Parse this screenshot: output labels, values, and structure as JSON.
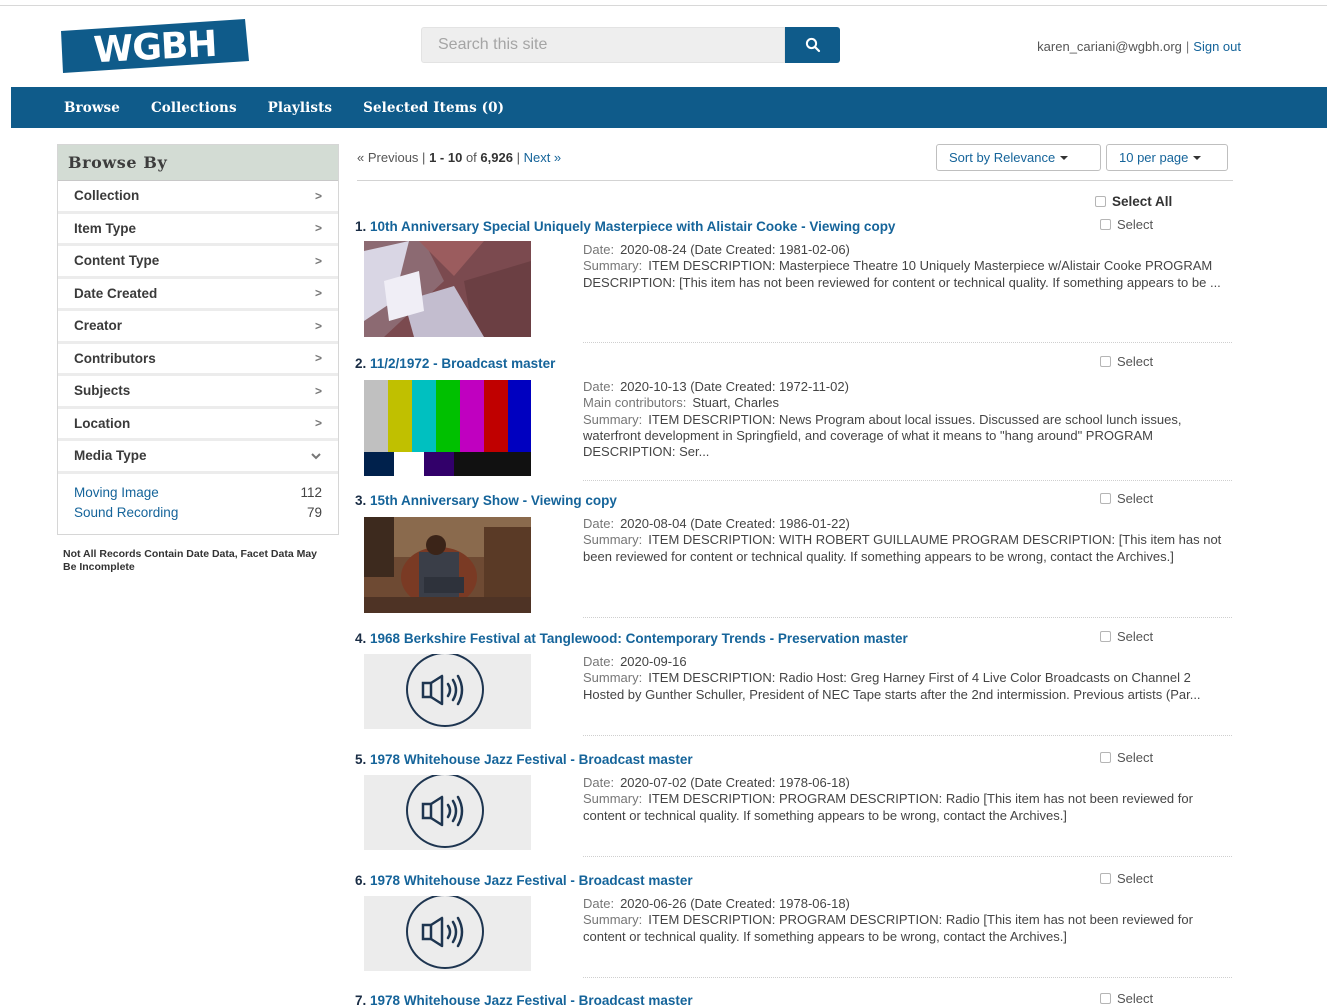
{
  "header": {
    "logo_text": "WGBH",
    "search_placeholder": "Search this site",
    "user_email": "karen_cariani@wgbh.org",
    "user_separator": "|",
    "sign_out_label": "Sign out"
  },
  "nav": {
    "items": [
      "Browse",
      "Collections",
      "Playlists",
      "Selected Items (0)"
    ]
  },
  "sidebar": {
    "title": "Browse By",
    "facets": [
      "Collection",
      "Item Type",
      "Content Type",
      "Date Created",
      "Creator",
      "Contributors",
      "Subjects",
      "Location",
      "Media Type"
    ],
    "media_type_options": [
      {
        "label": "Moving Image",
        "count": "112"
      },
      {
        "label": "Sound Recording",
        "count": "79"
      }
    ],
    "note": "Not All Records Contain Date Data, Facet Data May Be Incomplete"
  },
  "results_header": {
    "previous_label": "« Previous",
    "sep1": "|",
    "range": "1 - 10",
    "of_label": "of",
    "total": "6,926",
    "sep2": "|",
    "next_label": "Next »",
    "sort_label": "Sort by Relevance",
    "per_page_label": "10 per page",
    "select_all_label": "Select All"
  },
  "results": [
    {
      "num": "1.",
      "title": "10th Anniversary Special Uniquely Masterpiece with Alistair Cooke - Viewing copy",
      "select_label": "Select",
      "thumb": "video-still",
      "date_key": "Date:",
      "date": "2020-08-24 (Date Created: 1981-02-06)",
      "contributors_key": "",
      "contributors": "",
      "summary_key": "Summary:",
      "summary": "ITEM DESCRIPTION: Masterpiece Theatre 10 Uniquely Masterpiece w/Alistair Cooke PROGRAM DESCRIPTION: [This item has not been reviewed for content or technical quality. If something appears to be ..."
    },
    {
      "num": "2.",
      "title": "11/2/1972 - Broadcast master",
      "select_label": "Select",
      "thumb": "color-bars",
      "date_key": "Date:",
      "date": "2020-10-13 (Date Created: 1972-11-02)",
      "contributors_key": "Main contributors:",
      "contributors": "Stuart, Charles",
      "summary_key": "Summary:",
      "summary": "ITEM DESCRIPTION: News Program about local issues. Discussed are school lunch issues, waterfront development in Springfield, and coverage of what it means to \"hang around\" PROGRAM DESCRIPTION: Ser..."
    },
    {
      "num": "3.",
      "title": "15th Anniversary Show - Viewing copy",
      "select_label": "Select",
      "thumb": "video-still",
      "date_key": "Date:",
      "date": "2020-08-04 (Date Created: 1986-01-22)",
      "contributors_key": "",
      "contributors": "",
      "summary_key": "Summary:",
      "summary": "ITEM DESCRIPTION: WITH ROBERT GUILLAUME PROGRAM DESCRIPTION: [This item has not been reviewed for content or technical quality. If something appears to be wrong, contact the Archives.]"
    },
    {
      "num": "4.",
      "title": "1968 Berkshire Festival at Tanglewood: Contemporary Trends - Preservation master",
      "select_label": "Select",
      "thumb": "audio",
      "date_key": "Date:",
      "date": "2020-09-16",
      "contributors_key": "",
      "contributors": "",
      "summary_key": "Summary:",
      "summary": "ITEM DESCRIPTION: Radio Host: Greg Harney First of 4 Live Color Broadcasts on Channel 2 Hosted by Gunther Schuller, President of NEC Tape starts after the 2nd intermission. Previous artists (Par..."
    },
    {
      "num": "5.",
      "title": "1978 Whitehouse Jazz Festival - Broadcast master",
      "select_label": "Select",
      "thumb": "audio",
      "date_key": "Date:",
      "date": "2020-07-02 (Date Created: 1978-06-18)",
      "contributors_key": "",
      "contributors": "",
      "summary_key": "Summary:",
      "summary": "ITEM DESCRIPTION: PROGRAM DESCRIPTION: Radio [This item has not been reviewed for content or technical quality. If something appears to be wrong, contact the Archives.]"
    },
    {
      "num": "6.",
      "title": "1978 Whitehouse Jazz Festival - Broadcast master",
      "select_label": "Select",
      "thumb": "audio",
      "date_key": "Date:",
      "date": "2020-06-26 (Date Created: 1978-06-18)",
      "contributors_key": "",
      "contributors": "",
      "summary_key": "Summary:",
      "summary": "ITEM DESCRIPTION: PROGRAM DESCRIPTION: Radio [This item has not been reviewed for content or technical quality. If something appears to be wrong, contact the Archives.]"
    },
    {
      "num": "7.",
      "title": "1978 Whitehouse Jazz Festival - Broadcast master",
      "select_label": "Select",
      "thumb": "none",
      "date_key": "",
      "date": "",
      "contributors_key": "",
      "contributors": "",
      "summary_key": "",
      "summary": ""
    }
  ],
  "colors": {
    "brand_blue": "#0f5b8a",
    "link_blue": "#15649a",
    "sidebar_header_bg": "#d3dcd4"
  }
}
